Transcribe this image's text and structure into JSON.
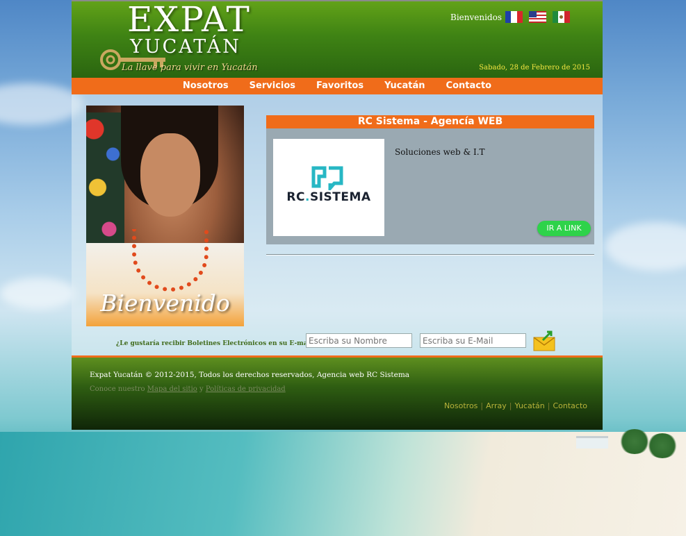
{
  "header": {
    "logo_title": "EXPAT",
    "logo_subtitle": "YUCATÁN",
    "logo_tagline": "La llave para vivir en Yucatán",
    "welcome": "Bienvenidos",
    "date": "Sabado, 28 de Febrero de 2015",
    "flags": [
      "france-flag",
      "usa-flag",
      "mexico-flag"
    ]
  },
  "nav": {
    "items": [
      "Nosotros",
      "Servicios",
      "Favoritos",
      "Yucatán",
      "Contacto"
    ]
  },
  "hero": {
    "caption": "Bienvenido"
  },
  "feature": {
    "title": "RC Sistema - Agencía WEB",
    "logo_text_a": "RC",
    "logo_text_dot": ".",
    "logo_text_b": "SISTEMA",
    "description": "Soluciones web & I.T",
    "button": "IR A LINK"
  },
  "newsletter": {
    "label": "¿Le gustaría recibir Boletines Electrónicos en su E-mail?",
    "name_placeholder": "Escriba su Nombre",
    "email_placeholder": "Escriba su E-Mail"
  },
  "footer": {
    "copyright": "Expat Yucatán © 2012-2015, Todos los derechos reservados, Agencia web RC Sistema",
    "sitemap_prefix": "Conoce nuestro",
    "sitemap_link": "Mapa del sitio",
    "sitemap_and": "y",
    "privacy_link": "Políticas de privacidad",
    "links": [
      "Nosotros",
      "Array",
      "Yucatán",
      "Contacto"
    ]
  },
  "colors": {
    "brand_green": "#3f8314",
    "accent_orange": "#f06c1a",
    "button_green": "#2ed34a",
    "date_yellow": "#f5e642"
  }
}
